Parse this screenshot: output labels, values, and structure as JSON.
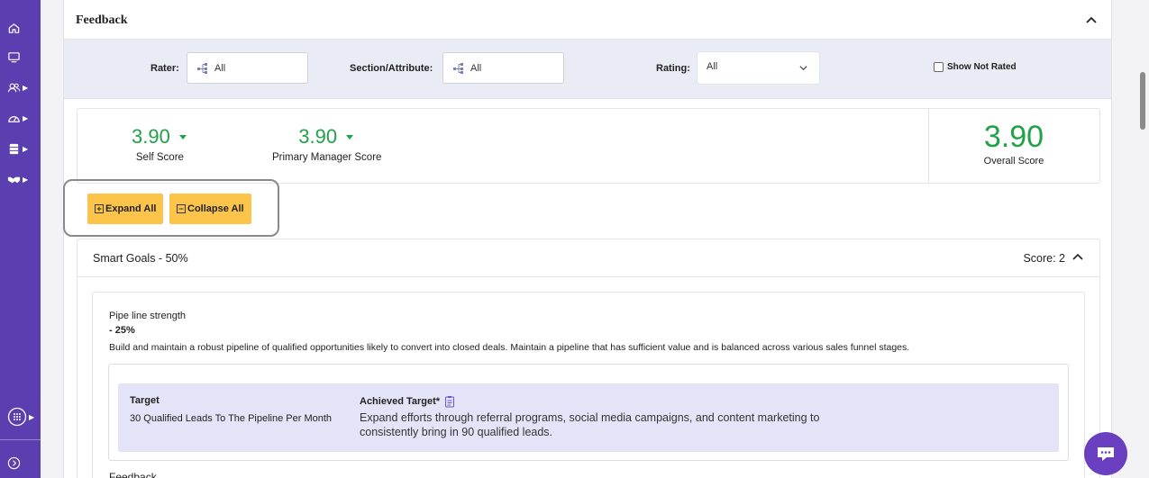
{
  "sidebar": {
    "items": [
      {
        "icon": "home-icon",
        "caret": false
      },
      {
        "icon": "monitor-icon",
        "caret": false
      },
      {
        "icon": "users-icon",
        "caret": true
      },
      {
        "icon": "gauge-icon",
        "caret": true
      },
      {
        "icon": "database-icon",
        "caret": true
      },
      {
        "icon": "handshake-icon",
        "caret": true
      },
      {
        "icon": "apps-icon",
        "caret": true
      },
      {
        "icon": "expand-sidebar-icon",
        "caret": false
      }
    ]
  },
  "panel": {
    "title": "Feedback"
  },
  "filters": {
    "rater_label": "Rater:",
    "rater_value": "All",
    "section_label": "Section/Attribute:",
    "section_value": "All",
    "rating_label": "Rating:",
    "rating_value": "All",
    "show_not_rated_label": "Show Not Rated",
    "show_not_rated_checked": false
  },
  "scores": {
    "self": {
      "value": "3.90",
      "label": "Self Score"
    },
    "primary_manager": {
      "value": "3.90",
      "label": "Primary Manager Score"
    },
    "overall": {
      "value": "3.90",
      "label": "Overall Score"
    }
  },
  "buttons": {
    "expand_all": "Expand All",
    "collapse_all": "Collapse All"
  },
  "goal_section": {
    "title": "Smart Goals - 50%",
    "score": "Score: 2",
    "item": {
      "name": "Pipe line strength",
      "weight": "- 25%",
      "description": "Build and maintain a robust pipeline of qualified opportunities likely to convert into closed deals. Maintain a pipeline that has sufficient value and is balanced across various sales funnel stages.",
      "target_heading": "Target",
      "target_value": "30 Qualified Leads To The Pipeline Per Month",
      "achieved_heading": "Achieved Target*",
      "achieved_value": "Expand efforts through referral programs, social media campaigns, and content marketing to consistently bring in 90 qualified leads."
    },
    "next_label": "Feedback"
  },
  "colors": {
    "sidebar": "#5b3fb0",
    "score_green": "#21a148",
    "button_yellow": "#fcc54a",
    "filter_bg": "#e9ebf5",
    "target_bg": "#e4e4f8",
    "chat": "#6a3fc0"
  }
}
